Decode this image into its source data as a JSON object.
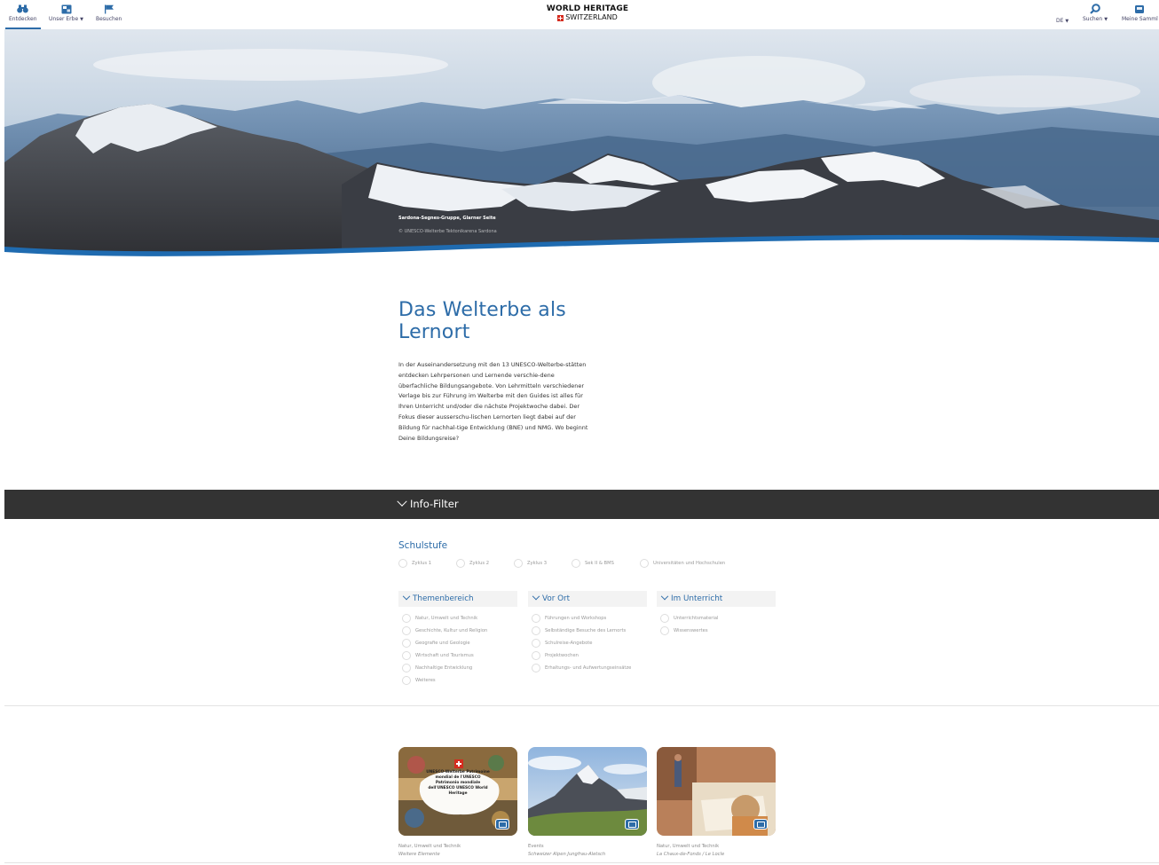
{
  "nav": {
    "left": [
      {
        "label": "Entdecken",
        "icon": "binoculars-icon",
        "active": true
      },
      {
        "label": "Unser Erbe",
        "icon": "map-book-icon",
        "dropdown": true
      },
      {
        "label": "Besuchen",
        "icon": "flag-icon"
      }
    ],
    "right": [
      {
        "label": "Suchen",
        "icon": "search-icon",
        "dropdown": true
      },
      {
        "label": "Meine Samml",
        "icon": "bookmark-stack-icon"
      }
    ],
    "language": "DE",
    "logo_line1": "WORLD HERITAGE",
    "logo_line2": "SWITZERLAND"
  },
  "hero": {
    "caption_title": "Sardona-Segnes-Gruppe, Glarner Seite",
    "caption_credit": "© UNESCO-Welterbe Tektonikarena Sardona"
  },
  "intro": {
    "title": "Das Welterbe als Lernort",
    "body": "In der Auseinandersetzung mit den 13 UNESCO-Welterbe-stätten entdecken Lehrpersonen und Lernende verschie-dene überfachliche Bildungsangebote. Von Lehrmitteln verschiedener Verlage bis zur Führung im Welterbe mit den Guides ist alles für Ihren Unterricht und/oder die nächste Projektwoche dabei. Der Fokus dieser ausserschu-lischen Lernorten liegt dabei auf der Bildung für nachhal-tige Entwicklung (BNE) und NMG. Wo beginnt Deine Bildungsreise?"
  },
  "filter": {
    "bar_label": "Info-Filter",
    "schulstufe_title": "Schulstufe",
    "levels": [
      "Zyklus 1",
      "Zyklus 2",
      "Zyklus 3",
      "Sek II & BMS",
      "Universitäten und Hochschulen"
    ],
    "groups": [
      {
        "title": "Themenbereich",
        "options": [
          "Natur, Umwelt und Technik",
          "Geschichte, Kultur und Religion",
          "Geografie und Geologie",
          "Wirtschaft und Tourismus",
          "Nachhaltige Entwicklung",
          "Weiteres"
        ]
      },
      {
        "title": "Vor Ort",
        "options": [
          "Führungen und Workshops",
          "Selbständige Besuche des Lernorts",
          "Schulreise-Angebote",
          "Projektwochen",
          "Erhaltungs- und Aufwertungseinsätze"
        ]
      },
      {
        "title": "Im Unterricht",
        "options": [
          "Unterrichtsmaterial",
          "Wissenswertes"
        ]
      }
    ]
  },
  "cards": [
    {
      "category": "Natur, Umwelt und Technik",
      "subtitle": "Weitere Elemente",
      "image_text": "UNESCO-Welterbe Patrimoine mondial de l'UNESCO Patrimonio mondiale dell'UNESCO UNESCO World Heritage"
    },
    {
      "category": "Events",
      "subtitle": "Schweizer Alpen Jungfrau-Aletsch"
    },
    {
      "category": "Natur, Umwelt und Technik",
      "subtitle": "La Chaux-de-Fonds / Le Locle"
    }
  ],
  "colors": {
    "accent": "#2d6ca8",
    "filter_bar": "#333333",
    "swiss_red": "#d52b1e"
  }
}
